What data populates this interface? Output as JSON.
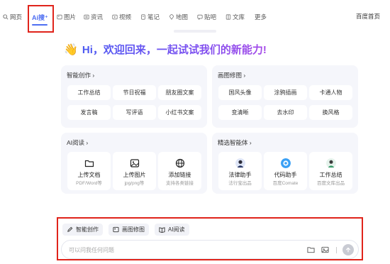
{
  "nav": {
    "items": [
      {
        "label": "网页",
        "icon": "search-icon"
      },
      {
        "label": "Ai搜⁺",
        "icon": "ai-search"
      },
      {
        "label": "图片",
        "icon": "image-icon"
      },
      {
        "label": "资讯",
        "icon": "news-icon"
      },
      {
        "label": "视频",
        "icon": "video-icon"
      },
      {
        "label": "笔记",
        "icon": "note-icon"
      },
      {
        "label": "地图",
        "icon": "map-icon"
      },
      {
        "label": "贴吧",
        "icon": "tieba-icon"
      },
      {
        "label": "文库",
        "icon": "doc-icon"
      },
      {
        "label": "更多",
        "icon": ""
      }
    ],
    "home": "百度首页"
  },
  "greeting": {
    "text": "Hi，欢迎回来，一起试试我们的新能力!"
  },
  "smart_create": {
    "title": "智能创作 ›",
    "chips": [
      "工作总结",
      "节日祝福",
      "朋友圈文案",
      "发言稿",
      "写评语",
      "小红书文案"
    ]
  },
  "image_edit": {
    "title": "画图修图 ›",
    "chips": [
      "国风头像",
      "涂鸦插画",
      "卡通人物",
      "变清晰",
      "去水印",
      "换风格"
    ]
  },
  "ai_read": {
    "title": "AI阅读 ›",
    "tiles": [
      {
        "title": "上传文档",
        "sub": "PDF/Word等",
        "icon": "folder-icon"
      },
      {
        "title": "上传图片",
        "sub": "jpg/png等",
        "icon": "image-icon"
      },
      {
        "title": "添加链接",
        "sub": "支持各类链接",
        "icon": "globe-icon"
      }
    ]
  },
  "agents": {
    "title": "精选智能体 ›",
    "tiles": [
      {
        "title": "法律助手",
        "sub": "法行宝出品",
        "icon": "lawyer-avatar-icon"
      },
      {
        "title": "代码助手",
        "sub": "百度Comate",
        "icon": "code-avatar-icon"
      },
      {
        "title": "工作总结",
        "sub": "百度文库出品",
        "icon": "worker-avatar-icon"
      }
    ]
  },
  "composer": {
    "quick": [
      "智能创作",
      "画图修图",
      "AI阅读"
    ],
    "placeholder": "可以问我任何问题"
  },
  "colors": {
    "accent": "#4e6ef2",
    "highlight": "#e0241b",
    "card_bg": "#f5f6fb"
  }
}
